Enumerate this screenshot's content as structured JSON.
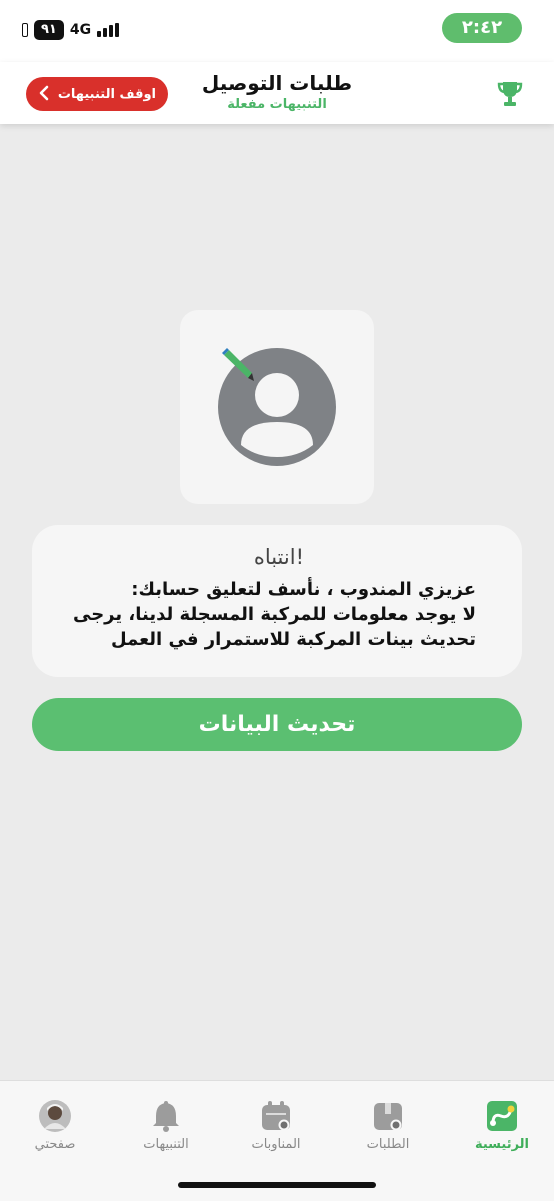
{
  "status_bar": {
    "battery": "٩١",
    "network": "4G",
    "time": "٢:٤٢"
  },
  "header": {
    "title": "طلبات التوصيل",
    "subtitle": "التنبيهات مفعلة",
    "stop_button_label": "اوقف التنبيهات",
    "stop_button_color": "#d9302b",
    "trophy_icon": "trophy-icon",
    "accent_color": "#4bb567"
  },
  "alert": {
    "title": "انتباه!",
    "message": "عزيزي المندوب ، نأسف لتعليق حسابك:\nلا يوجد معلومات للمركبة المسجلة لدينا، يرجى\nتحديث بينات المركبة للاستمرار في العمل",
    "avatar_icon": "user-avatar-icon",
    "edit_icon": "pencil-icon"
  },
  "update_button_label": "تحديث البيانات",
  "bottom_nav": {
    "items": [
      {
        "label": "الرئيسية",
        "icon": "route-icon",
        "active": true
      },
      {
        "label": "الطلبات",
        "icon": "package-icon",
        "active": false
      },
      {
        "label": "المناوبات",
        "icon": "calendar-icon",
        "active": false
      },
      {
        "label": "التنبيهات",
        "icon": "bell-icon",
        "active": false
      },
      {
        "label": "صفحتي",
        "icon": "profile-photo",
        "active": false
      }
    ]
  }
}
